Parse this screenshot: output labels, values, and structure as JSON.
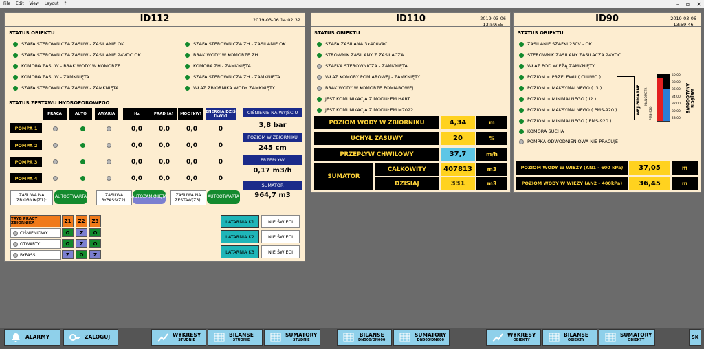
{
  "menu": [
    "File",
    "Edit",
    "View",
    "Layout",
    "?"
  ],
  "window": {
    "minimize": "–",
    "restore": "▫",
    "close": "✕"
  },
  "id112": {
    "title": "ID112",
    "datetime": "2019-03-06 14:02:32",
    "status_title": "STATUS OBIEKTU",
    "status_left": [
      "SZAFA STEROWNICZA ZASUW - ZASILANIE OK",
      "SZAFA STEROWNICZA ZASUW - ZASILANIE 24VDC OK",
      "KOMORA ZASUW - BRAK WODY W KOMORZE",
      "KOMORA ZASUW - ZAMKNIĘTA",
      "SZAFA STEROWNICZA ZASUW - ZAMKNIĘTA"
    ],
    "status_right": [
      "SZAFA STEROWNICZA ZH - ZASILANIE OK",
      "BRAK WODY W KOMORZE ZH",
      "KOMORA ZH - ZAMKNIĘTA",
      "SZAFA STEROWNICZA ZH - ZAMKNIĘTA",
      "WŁAZ ZBIORNIKA WODY ZAMKNIĘTY"
    ],
    "pump_section": "STATUS ZESTAWU HYDROFOROWEGO",
    "pump_headers": [
      "PRACA",
      "AUTO",
      "AWARIA",
      "Hz",
      "PRĄD [A]",
      "MOC [kW]",
      "ENERGIA DZIŚ [kWh]"
    ],
    "pumps": [
      {
        "name": "POMPA 1",
        "hz": "0,0",
        "amp": "0,0",
        "kw": "0,0",
        "kwh": "0"
      },
      {
        "name": "POMPA 2",
        "hz": "0,0",
        "amp": "0,0",
        "kw": "0,0",
        "kwh": "0"
      },
      {
        "name": "POMPA 3",
        "hz": "0,0",
        "amp": "0,0",
        "kw": "0,0",
        "kwh": "0"
      },
      {
        "name": "POMPA 4",
        "hz": "0,0",
        "amp": "0,0",
        "kw": "0,0",
        "kwh": "0"
      }
    ],
    "pressure_label": "CIŚNIENIE NA WYJŚCIU",
    "pressure": "3,8 bar",
    "level_label": "POZIOM W ZBIORNIKU",
    "level": "245 cm",
    "flow_label": "PRZEPŁYW",
    "flow": "0,17 m3/h",
    "sum_label": "SUMATOR",
    "sum": "964,7 m3",
    "valves": [
      {
        "label": "ZASUWA NA ZBIORNIK(Z1):",
        "s1": "AUTO",
        "s2": "OTWARTA"
      },
      {
        "label": "ZASUWA BYPASS(Z2):",
        "s1": "AUTO",
        "s2": "ZAMKNIĘTA"
      },
      {
        "label": "ZASUWA NA ZESTAW(Z3):",
        "s1": "AUTO",
        "s2": "OTWARTA"
      }
    ],
    "mode_title": "TRYB PRACY ZBIORNIKA",
    "mode_cols": [
      "Z1",
      "Z2",
      "Z3"
    ],
    "modes": [
      {
        "name": "CIŚNIENIOWY",
        "z": [
          "O",
          "Z",
          "O"
        ]
      },
      {
        "name": "OTWARTY",
        "z": [
          "O",
          "Z",
          "O"
        ]
      },
      {
        "name": "BYPASS",
        "z": [
          "Z",
          "O",
          "Z"
        ]
      }
    ],
    "lights": [
      {
        "name": "LATARNIA K1",
        "state": "NIE ŚWIECI"
      },
      {
        "name": "LATARNIA K2",
        "state": "NIE ŚWIECI"
      },
      {
        "name": "LATARNIA K3",
        "state": "NIE ŚWIECI"
      }
    ]
  },
  "id110": {
    "title": "ID110",
    "date": "2019-03-06",
    "time": "13:59:55",
    "status_title": "STATUS OBIEKTU",
    "status": [
      "SZAFA ZASILANA 3x400VAC",
      "STROWNIK ZASILANY Z ZASILACZA",
      "SZAFKA STEROWNICZA - ZAMKNIĘTA",
      "WŁAZ KOMORY POMIAROWEJ - ZAMKNIĘTY",
      "BRAK WODY W KOMORZE POMIAROWEJ",
      "JEST KOMUNIKACJA Z MODUŁEM HART",
      "JEST KOMUNIKACJA Z MODUŁEM M7022"
    ],
    "rows": [
      {
        "label": "POZIOM WODY W ZBIORNIKU",
        "value": "4,34",
        "unit": "m"
      },
      {
        "label": "UCHYŁ ZASUWY",
        "value": "20",
        "unit": "%"
      },
      {
        "label": "PRZEPŁYW CHWILOWY",
        "value": "37,7",
        "unit": "m/h"
      }
    ],
    "sumator": "SUMATOR",
    "sum_rows": [
      {
        "label": "CAŁKOWITY",
        "value": "407813",
        "unit": "m3"
      },
      {
        "label": "DZISIAJ",
        "value": "331",
        "unit": "m3"
      }
    ]
  },
  "id90": {
    "title": "ID90",
    "date": "2019-03-06",
    "time": "13:59:46",
    "status_title": "STATUS OBIEKTU",
    "status_top": [
      "ZASILANIE SZAFKI 230V - OK",
      "STEROWNIK ZASILANY ZASILACZA 24VDC",
      "WŁAZ POD WIEŻĄ ZAMKNIĘTY"
    ],
    "status_levels": [
      "POZIOM < PRZELEWU ( CLUWO )",
      "POZIOM < MAKSYMALNEGO ( I3 )",
      "POZIOM > MINIMALNEGO ( I2 )",
      "POZIOM < MAKSYMALNEGO ( PMS-920 )",
      "POZIOM > MINIMALNEGO ( PMS-920 )"
    ],
    "status_bottom": [
      "KOMORA SUCHA",
      "POMPKA ODWODNIENIOWA NIE PRACUJE"
    ],
    "bin_label": "WEJ.BINARNE",
    "bin_sub": "MANOMETR",
    "ana_label": "WEJŚCIE ANALOGOWE",
    "ana_sub": "PMS-920",
    "scale": [
      "40,00",
      "38,00",
      "36,00",
      "34,00",
      "32,00",
      "30,00",
      "28,00"
    ],
    "rows": [
      {
        "label": "POZIOM WODY W WIEŻY (AN1 - 600 kPa)",
        "value": "37,05",
        "unit": "m"
      },
      {
        "label": "POZIOM WODY W WIEŻY (AN2 - 400kPa)",
        "value": "36,45",
        "unit": "m"
      }
    ]
  },
  "bottom": {
    "alarms": "ALARMY",
    "login": "ZALOGUJ",
    "buttons": [
      {
        "t": "WYKRESY",
        "s": "STUDNIE"
      },
      {
        "t": "BILANSE",
        "s": "STUDNIE"
      },
      {
        "t": "SUMATORY",
        "s": "STUDNIE"
      },
      {
        "t": "BILANSE",
        "s": "DN500/DN600"
      },
      {
        "t": "SUMATORY",
        "s": "DN500/DN600"
      },
      {
        "t": "WYKRESY",
        "s": "OBIEKTY"
      },
      {
        "t": "BILANSE",
        "s": "OBIEKTY"
      },
      {
        "t": "SUMATORY",
        "s": "OBIEKTY"
      }
    ],
    "lang": "SK"
  }
}
